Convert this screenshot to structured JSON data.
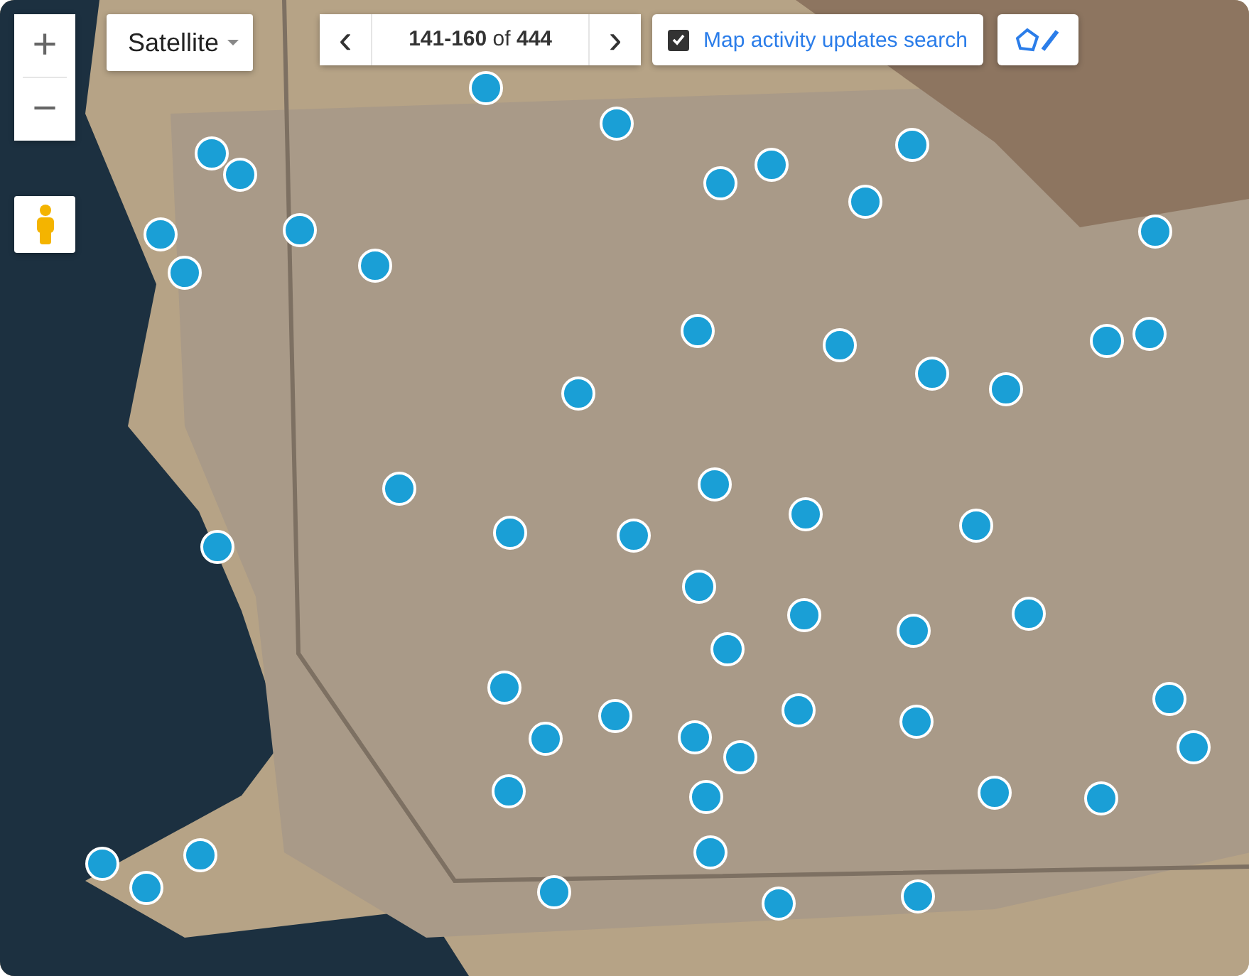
{
  "map_type": {
    "label": "Satellite"
  },
  "zoom": {
    "in": "+",
    "out": "−"
  },
  "pager": {
    "prev": "‹",
    "range": "**141-160** of **444**",
    "next": "›"
  },
  "search_toggle": {
    "label": "Map activity updates search",
    "checked": true
  }
}
